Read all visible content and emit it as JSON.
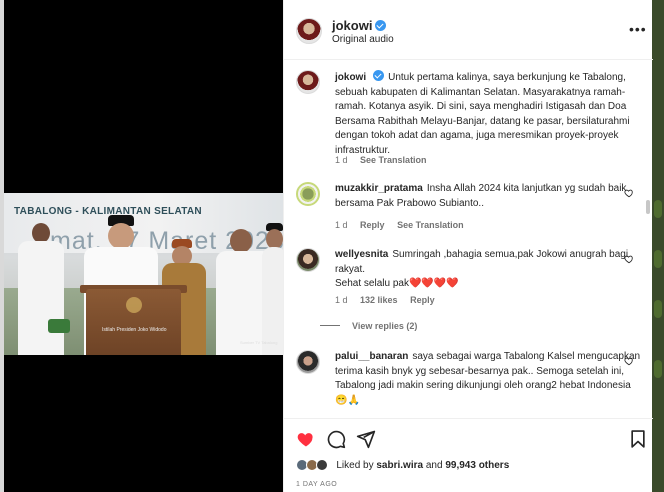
{
  "video": {
    "banner_title": "TABALONG - KALIMANTAN SELATAN",
    "banner_date": "mat, 17 Maret 2023",
    "caption_left": "Istilah Presiden Joko Widodo",
    "caption_right": "Sumber TV Tabalong"
  },
  "header": {
    "username": "jokowi",
    "audio": "Original audio",
    "more": "•••"
  },
  "caption": {
    "username": "jokowi",
    "text": "Untuk pertama kalinya, saya berkunjung ke Tabalong, sebuah kabupaten di Kalimantan Selatan. Masyarakatnya ramah-ramah. Kotanya asyik. Di sini, saya menghadiri Istigasah dan Doa Bersama Rabithah Melayu-Banjar, datang ke pasar, bersilaturahmi dengan tokoh adat dan agama, juga meresmikan proyek-proyek infrastruktur.",
    "time": "1 d",
    "see_translation": "See Translation"
  },
  "comments": [
    {
      "username": "muzakkir_pratama",
      "text": "Insha Allah 2024 kita lanjutkan yg sudah baik bersama Pak Prabowo Subianto..",
      "time": "1 d",
      "reply": "Reply",
      "see_translation": "See Translation"
    },
    {
      "username": "wellyesnita",
      "text_line1": "Sumringah ,bahagia semua,pak Jokowi anugrah bagi rakyat.",
      "text_line2": "Sehat selalu pak❤️❤️❤️❤️",
      "time": "1 d",
      "likes": "132 likes",
      "reply": "Reply",
      "view_replies": "View replies (2)"
    },
    {
      "username": "palui__banaran",
      "text": "saya sebagai warga Tabalong Kalsel mengucapkan terima kasih bnyk yg sebesar-besarnya pak.. Semoga setelah ini, Tabalong jadi makin sering dikunjungi oleh orang2 hebat Indonesia 😁🙏"
    }
  ],
  "actions": {
    "liked_by_prefix": "Liked by",
    "liked_by_user": "sabri.wira",
    "and": "and",
    "others": "99,943 others",
    "time_ago": "1 DAY AGO"
  },
  "colors": {
    "like_red": "#ff3040",
    "verified_blue": "#3897f0",
    "muted_text": "#737373"
  },
  "icons": [
    "heart-icon",
    "comment-icon",
    "share-icon",
    "bookmark-icon",
    "verified-icon",
    "more-icon"
  ]
}
